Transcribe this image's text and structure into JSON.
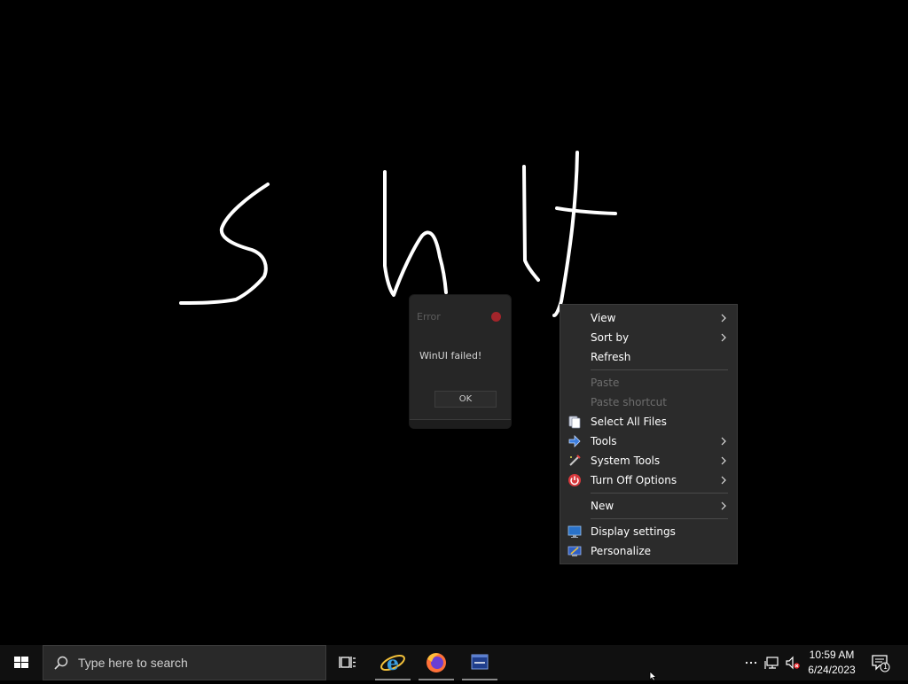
{
  "desktop": {
    "background_color": "#000000"
  },
  "error_dialog": {
    "title": "Error",
    "message": "WinUI failed!",
    "ok_label": "OK"
  },
  "context_menu": {
    "items": [
      {
        "label": "View",
        "submenu": true,
        "enabled": true,
        "icon": ""
      },
      {
        "label": "Sort by",
        "submenu": true,
        "enabled": true,
        "icon": ""
      },
      {
        "label": "Refresh",
        "submenu": false,
        "enabled": true,
        "icon": ""
      },
      {
        "label": "Paste",
        "submenu": false,
        "enabled": false,
        "icon": ""
      },
      {
        "label": "Paste shortcut",
        "submenu": false,
        "enabled": false,
        "icon": ""
      },
      {
        "label": "Select All Files",
        "submenu": false,
        "enabled": true,
        "icon": "copy-files-icon"
      },
      {
        "label": "Tools",
        "submenu": true,
        "enabled": true,
        "icon": "blue-arrow-icon"
      },
      {
        "label": "System Tools",
        "submenu": true,
        "enabled": true,
        "icon": "wand-icon"
      },
      {
        "label": "Turn Off Options",
        "submenu": true,
        "enabled": true,
        "icon": "power-icon"
      },
      {
        "label": "New",
        "submenu": true,
        "enabled": true,
        "icon": ""
      },
      {
        "label": "Display settings",
        "submenu": false,
        "enabled": true,
        "icon": "monitor-icon"
      },
      {
        "label": "Personalize",
        "submenu": false,
        "enabled": true,
        "icon": "personalize-icon"
      }
    ]
  },
  "taskbar": {
    "search_placeholder": "Type here to search",
    "apps": [
      "task-view-icon",
      "internet-explorer-icon",
      "firefox-icon",
      "app-window-icon"
    ],
    "clock": {
      "time": "10:59 AM",
      "date": "6/24/2023"
    },
    "notification_count": "1"
  },
  "colors": {
    "menu_bg": "#2b2b2b",
    "taskbar_bg": "#101010",
    "error_close": "#a3252b"
  }
}
